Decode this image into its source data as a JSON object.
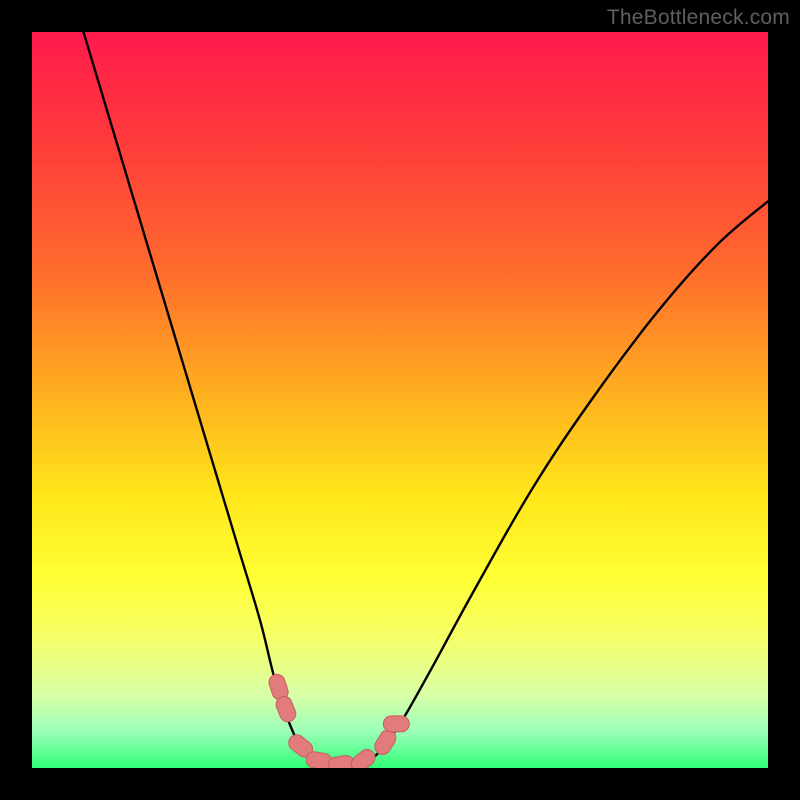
{
  "watermark": "TheBottleneck.com",
  "colors": {
    "frame": "#000000",
    "gradient_stops": [
      {
        "offset": 0.0,
        "color": "#ff1a4d"
      },
      {
        "offset": 0.15,
        "color": "#ff3b3b"
      },
      {
        "offset": 0.32,
        "color": "#ff6a2d"
      },
      {
        "offset": 0.5,
        "color": "#ffb21f"
      },
      {
        "offset": 0.63,
        "color": "#ffe61a"
      },
      {
        "offset": 0.74,
        "color": "#ffff33"
      },
      {
        "offset": 0.82,
        "color": "#f6ff66"
      },
      {
        "offset": 0.9,
        "color": "#d9ffa6"
      },
      {
        "offset": 0.95,
        "color": "#9cffb8"
      },
      {
        "offset": 1.0,
        "color": "#2fff77"
      }
    ],
    "curve": "#000000",
    "marker_fill": "#e27b7b",
    "marker_stroke": "#c75f5f"
  },
  "chart_data": {
    "type": "line",
    "title": "",
    "xlabel": "",
    "ylabel": "",
    "xlim": [
      0,
      100
    ],
    "ylim": [
      0,
      100
    ],
    "left_branch": [
      {
        "x": 7,
        "y": 100
      },
      {
        "x": 10,
        "y": 90
      },
      {
        "x": 13,
        "y": 80
      },
      {
        "x": 16,
        "y": 70
      },
      {
        "x": 19,
        "y": 60
      },
      {
        "x": 22,
        "y": 50
      },
      {
        "x": 25,
        "y": 40
      },
      {
        "x": 28,
        "y": 30
      },
      {
        "x": 31,
        "y": 20
      },
      {
        "x": 33,
        "y": 12
      },
      {
        "x": 35,
        "y": 6
      },
      {
        "x": 37,
        "y": 2
      },
      {
        "x": 39,
        "y": 0.5
      }
    ],
    "right_branch": [
      {
        "x": 45,
        "y": 0.5
      },
      {
        "x": 47,
        "y": 2
      },
      {
        "x": 50,
        "y": 6
      },
      {
        "x": 54,
        "y": 13
      },
      {
        "x": 60,
        "y": 24
      },
      {
        "x": 68,
        "y": 38
      },
      {
        "x": 76,
        "y": 50
      },
      {
        "x": 85,
        "y": 62
      },
      {
        "x": 93,
        "y": 71
      },
      {
        "x": 100,
        "y": 77
      }
    ],
    "bottom_segment": [
      {
        "x": 39,
        "y": 0.5
      },
      {
        "x": 45,
        "y": 0.5
      }
    ],
    "markers": [
      {
        "x": 33.5,
        "y": 11
      },
      {
        "x": 34.5,
        "y": 8
      },
      {
        "x": 36.5,
        "y": 3
      },
      {
        "x": 39,
        "y": 1
      },
      {
        "x": 42,
        "y": 0.5
      },
      {
        "x": 45,
        "y": 1
      },
      {
        "x": 48,
        "y": 3.5
      },
      {
        "x": 49.5,
        "y": 6
      }
    ]
  }
}
